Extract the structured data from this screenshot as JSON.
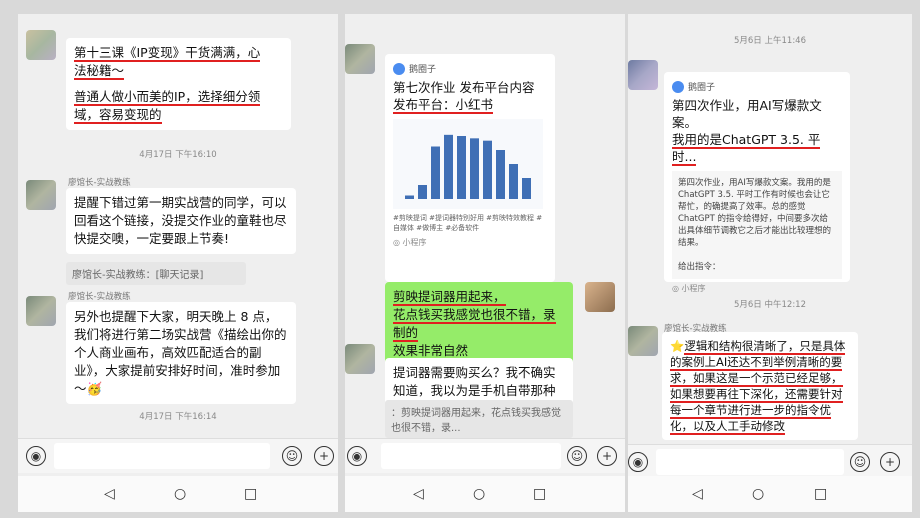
{
  "panel1": {
    "msg1": {
      "line1": "第十三课《IP变现》干货满满，心",
      "line2": "法秘籍～",
      "line3": "普通人做小而美的IP，选择细分领",
      "line4": "域，容易变现的"
    },
    "time1": "4月17日 下午16:10",
    "msg2": {
      "name": "廖馆长-实战教练",
      "text": "提醒下错过第一期实战营的同学，可以回看这个链接，没提交作业的童鞋也尽快提交噢，一定要跟上节奏!"
    },
    "record": "廖馆长-实战教练：[聊天记录]",
    "msg3": {
      "name": "廖馆长-实战教练",
      "text": "另外也提醒下大家，明天晚上 8 点，我们将进行第二场实战营《描绘出你的个人商业画布，高效匹配适合的副业》，大家提前安排好时间，准时参加～",
      "emoji": "🥳"
    },
    "time2": "4月17日 下午16:14"
  },
  "panel2": {
    "card": {
      "brand": "鹅圈子",
      "title1": "第七次作业 发布平台内容",
      "title2": "发布平台：小红书",
      "caption": "#剪映提词  #提词器特别好用  #剪映特效教程  #自媒体  #做博主  #必备软件",
      "footer": "小程序"
    },
    "chart_data": {
      "type": "bar",
      "values": [
        3,
        12,
        45,
        55,
        54,
        52,
        50,
        42,
        30,
        18
      ]
    },
    "msg_green": {
      "line1": "剪映提词器用起来，",
      "line2": "花点钱买我感觉也很不错，录制的",
      "line3": "效果非常自然"
    },
    "msg_q": {
      "text": "提词器需要购买么？我不确实知道，我以为是手机自带那种"
    },
    "quote": "：剪映提词器用起来，花点钱买我感觉也很不错，录..."
  },
  "panel3": {
    "time1": "5月6日 上午11:46",
    "card": {
      "brand": "鹅圈子",
      "title1": "第四次作业，用AI写爆款文案。",
      "title2": "我用的是ChatGPT 3.5. 平时...",
      "body": "第四次作业，用AI写爆款文案。我用的是ChatGPT 3.5. 平时工作有时候也会让它帮忙，的确提高了效率。总的感觉ChatGPT 的指令给得好，中间要多次给出具体细节调教它之后才能出比较理想的结果。",
      "body2": "给出指令：",
      "footer": "小程序"
    },
    "time2": "5月6日 中午12:12",
    "msg": {
      "name": "廖馆长-实战教练",
      "l1": "逻辑和结构很清晰了，只是具体",
      "l2": "的案例上AI还达不到举例清晰的要",
      "l3": "求，如果这是一个示范已经足够，",
      "l4": "如果想要再往下深化，还需要针对",
      "l5": "每一个章节进行进一步的指令优",
      "l6": "化，以及人工手动修改"
    }
  }
}
